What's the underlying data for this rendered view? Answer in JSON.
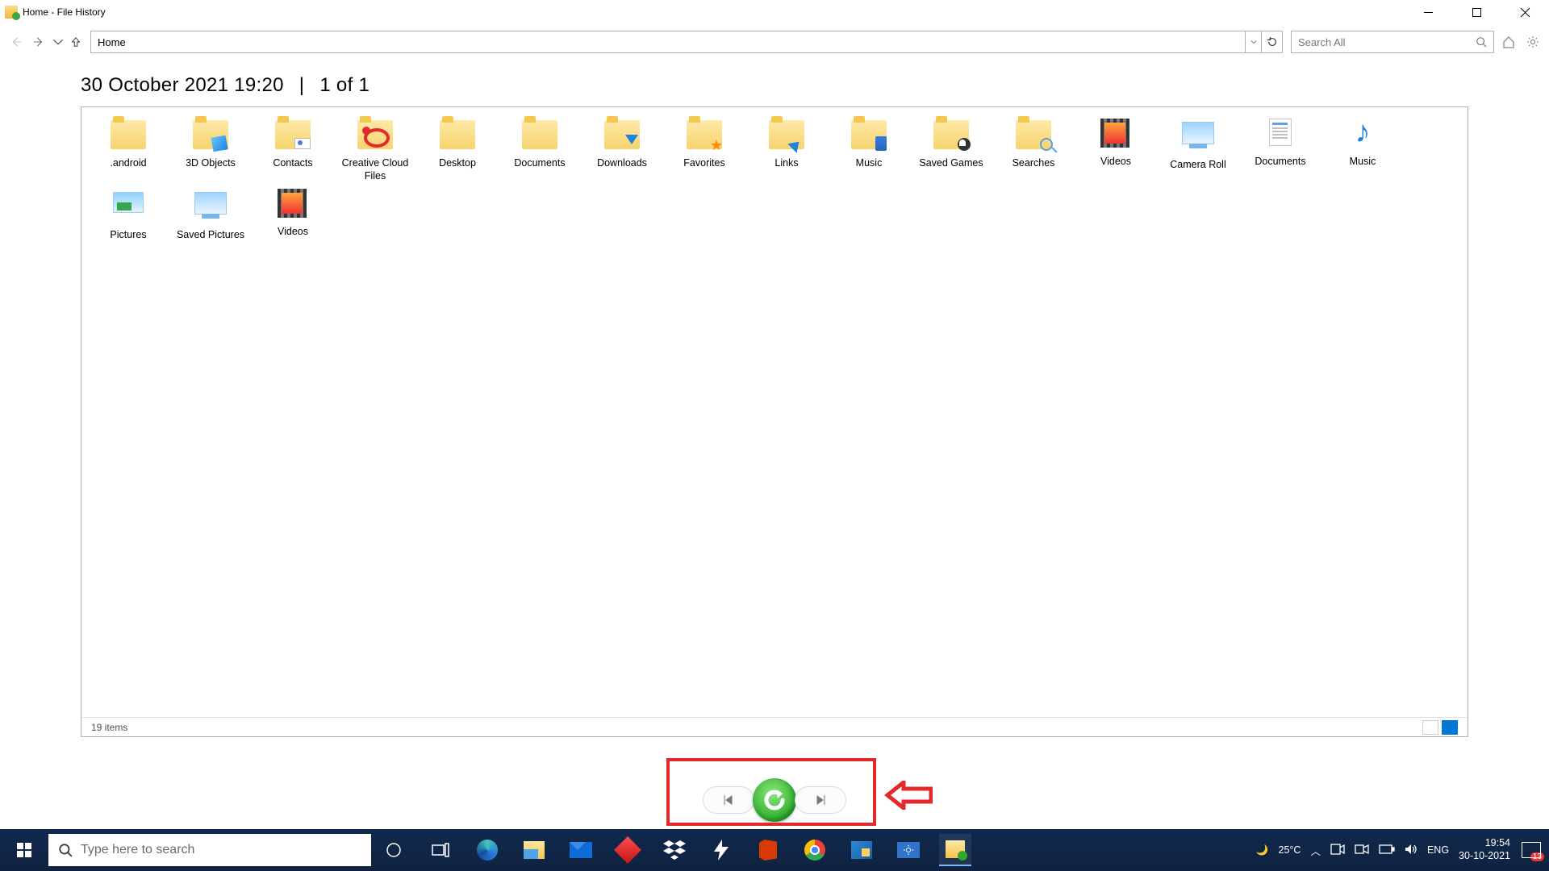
{
  "titlebar": {
    "title": "Home - File History"
  },
  "nav": {
    "address_value": "Home",
    "search_placeholder": "Search All"
  },
  "header": {
    "timestamp": "30 October 2021 19:20",
    "separator": "|",
    "pager": "1 of 1"
  },
  "status": {
    "count": "19 items"
  },
  "folders": [
    {
      "label": ".android",
      "type": "folder"
    },
    {
      "label": "3D Objects",
      "type": "folder",
      "overlay": "cube"
    },
    {
      "label": "Contacts",
      "type": "folder",
      "overlay": "contact"
    },
    {
      "label": "Creative Cloud Files",
      "type": "folder",
      "overlay": "cloud"
    },
    {
      "label": "Desktop",
      "type": "folder"
    },
    {
      "label": "Documents",
      "type": "folder"
    },
    {
      "label": "Downloads",
      "type": "folder",
      "overlay": "down"
    },
    {
      "label": "Favorites",
      "type": "folder",
      "overlay": "star"
    },
    {
      "label": "Links",
      "type": "folder",
      "overlay": "link"
    },
    {
      "label": "Music",
      "type": "folder",
      "overlay": "note"
    },
    {
      "label": "Saved Games",
      "type": "folder",
      "overlay": "save"
    },
    {
      "label": "Searches",
      "type": "folder",
      "overlay": "mag"
    },
    {
      "label": "Videos",
      "type": "film"
    },
    {
      "label": "Camera Roll",
      "type": "libmon"
    },
    {
      "label": "Documents",
      "type": "libdoc"
    },
    {
      "label": "Music",
      "type": "libmus"
    },
    {
      "label": "Pictures",
      "type": "libpic"
    },
    {
      "label": "Saved Pictures",
      "type": "libmon"
    },
    {
      "label": "Videos",
      "type": "film"
    }
  ],
  "taskbar": {
    "search_placeholder": "Type here to search",
    "weather": "25°C",
    "lang": "ENG",
    "time": "19:54",
    "date": "30-10-2021",
    "action_badge": "13"
  }
}
